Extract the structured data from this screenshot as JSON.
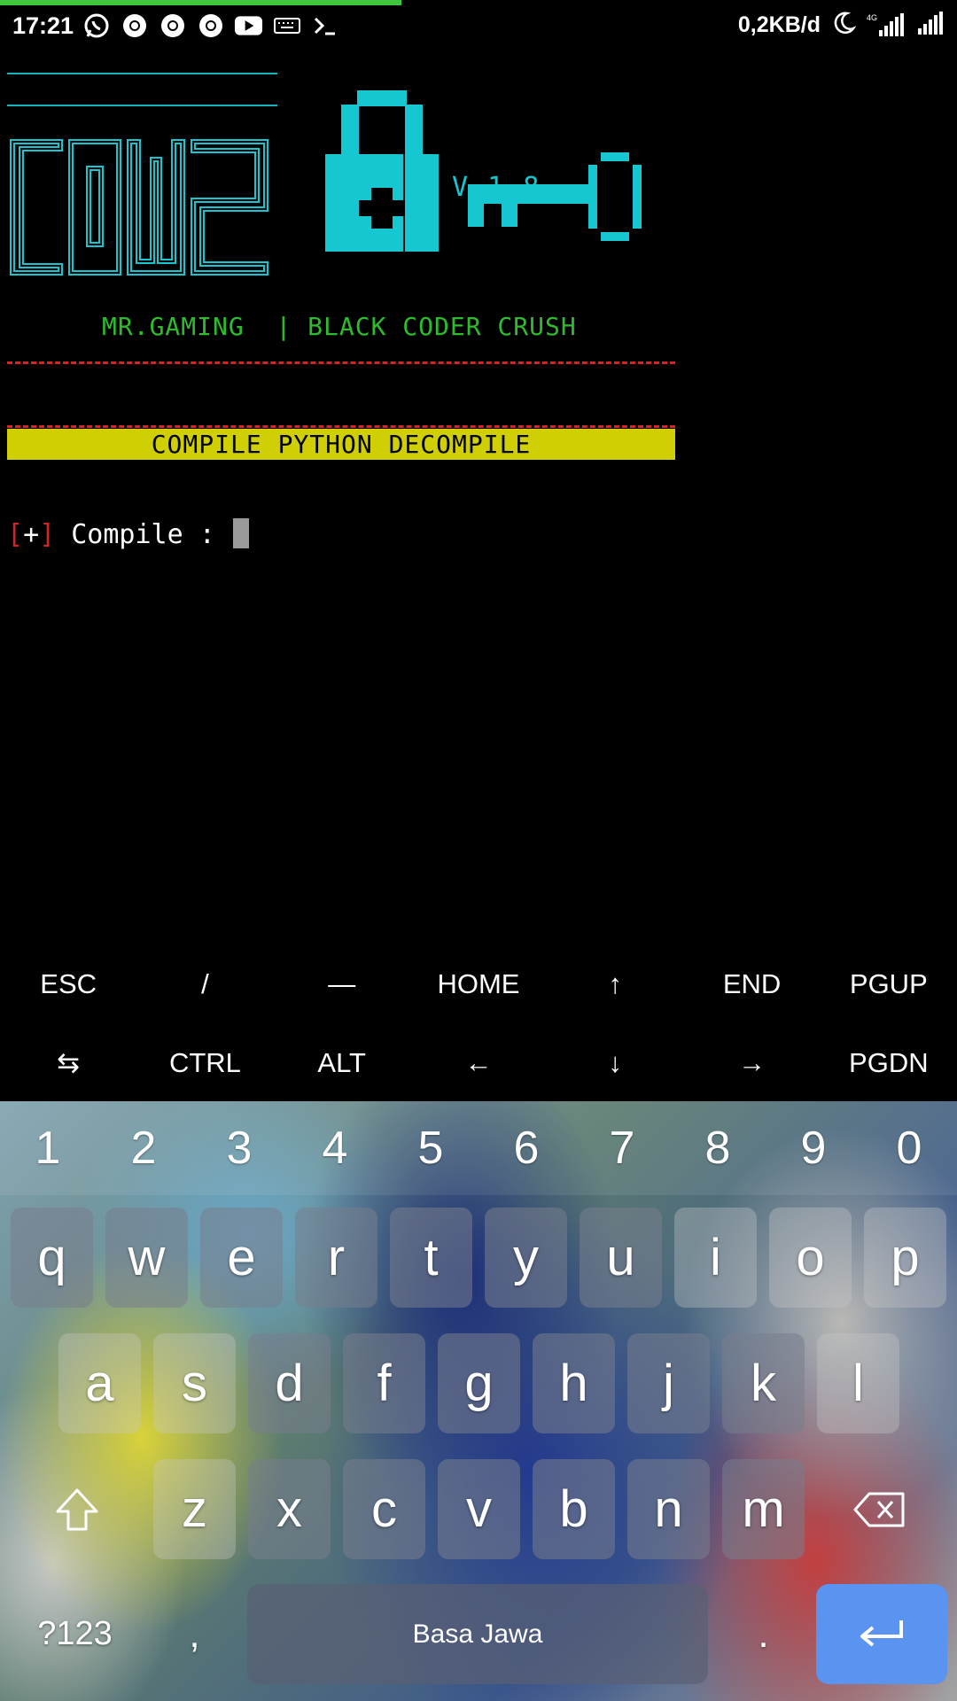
{
  "status_bar": {
    "time": "17:21",
    "notification_icons": [
      "whatsapp-icon",
      "chrome-icon",
      "chrome-icon",
      "chrome-icon",
      "youtube-icon",
      "keyboard-icon",
      "terminal-icon"
    ],
    "data_rate": "0,2KB/d",
    "network_label": "4G",
    "progress_color": "#3fc63f"
  },
  "terminal": {
    "logo_text": "COWZ",
    "version": "V.1.8",
    "credits": "MR.GAMING  | BLACK CODER CRUSH",
    "banner": "COMPILE PYTHON DECOMPILE",
    "prompt_open": "[",
    "prompt_plus": "+",
    "prompt_close": "]",
    "prompt_label": " Compile : ",
    "colors": {
      "cyan": "#16c6d0",
      "green": "#2dbc2d",
      "red": "#d42525",
      "banner_bg": "#cfcf04"
    }
  },
  "extra_keys": {
    "row1": [
      "ESC",
      "/",
      "—",
      "HOME",
      "↑",
      "END",
      "PGUP"
    ],
    "row2": [
      "⇆",
      "CTRL",
      "ALT",
      "←",
      "↓",
      "→",
      "PGDN"
    ]
  },
  "keyboard": {
    "numbers": [
      "1",
      "2",
      "3",
      "4",
      "5",
      "6",
      "7",
      "8",
      "9",
      "0"
    ],
    "row1": [
      "q",
      "w",
      "e",
      "r",
      "t",
      "y",
      "u",
      "i",
      "o",
      "p"
    ],
    "row2": [
      "a",
      "s",
      "d",
      "f",
      "g",
      "h",
      "j",
      "k",
      "l"
    ],
    "row3": [
      "z",
      "x",
      "c",
      "v",
      "b",
      "n",
      "m"
    ],
    "symbols_key": "?123",
    "comma_key": ",",
    "space_label": "Basa Jawa",
    "period_key": ".",
    "enter_color": "#5b93f0"
  }
}
